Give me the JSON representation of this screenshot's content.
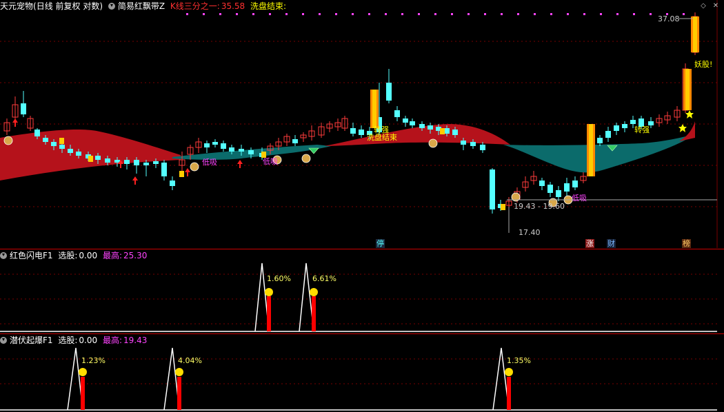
{
  "main": {
    "stock_name": "天元宠物",
    "period_label": "(日线 前复权 对数)",
    "indicator_name": "简易红飘带Z",
    "k_third_label": "K线三分之一:",
    "k_third_value": "35.58",
    "wash_label": "洗盘结束:",
    "price_high": "37.08",
    "price_low": "17.40",
    "range_label": "19.43 - 19.60",
    "annotations": {
      "dixi_1": "低吸",
      "dixi_2": "低吸",
      "dixi_3": "低吸",
      "zhuanqiang_1": "转强",
      "zhuanqiang_2": "转强",
      "xipan_end": "洗盘结束",
      "yaogu": "妖股!"
    },
    "event_tags": {
      "ting": "停",
      "zhang": "涨",
      "cai": "财",
      "bang": "榜"
    }
  },
  "panel1": {
    "name": "红色闪电F1",
    "select_label": "选股:",
    "select_value": "0.00",
    "max_label": "最高:",
    "max_value": "25.30",
    "pct_1": "1.60%",
    "pct_2": "6.61%"
  },
  "panel2": {
    "name": "潜伏起爆F1",
    "select_label": "选股:",
    "select_value": "0.00",
    "max_label": "最高:",
    "max_value": "19.43",
    "pct_1": "1.23%",
    "pct_2": "4.04%",
    "pct_3": "1.35%"
  },
  "colors": {
    "up": "#ff3b3b",
    "down": "#54ffff",
    "ribbon_red": "#b5121b",
    "ribbon_teal": "#0b6b6b",
    "gold": "#ffcc00",
    "magenta": "#ff44ff",
    "yellow_text": "#ffff00"
  }
}
